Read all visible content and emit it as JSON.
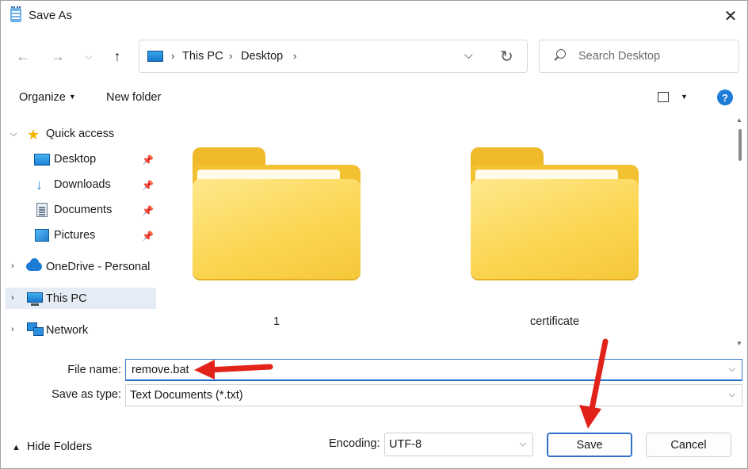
{
  "window": {
    "title": "Save As"
  },
  "nav": {
    "breadcrumb": [
      "This PC",
      "Desktop"
    ],
    "search_placeholder": "Search Desktop"
  },
  "commands": {
    "organize": "Organize",
    "new_folder": "New folder"
  },
  "sidebar": {
    "quick_access": "Quick access",
    "items": [
      {
        "label": "Desktop",
        "icon": "desktop-icon",
        "pinned": true
      },
      {
        "label": "Downloads",
        "icon": "download-icon",
        "pinned": true
      },
      {
        "label": "Documents",
        "icon": "documents-icon",
        "pinned": true
      },
      {
        "label": "Pictures",
        "icon": "pictures-icon",
        "pinned": true
      }
    ],
    "onedrive": "OneDrive - Personal",
    "this_pc": "This PC",
    "network": "Network",
    "selected": "This PC"
  },
  "folders": [
    {
      "name": "1"
    },
    {
      "name": "certificate"
    }
  ],
  "form": {
    "file_name_label": "File name:",
    "file_name_value": "remove.bat",
    "save_type_label": "Save as type:",
    "save_type_value": "Text Documents (*.txt)"
  },
  "footer": {
    "hide_folders": "Hide Folders",
    "encoding_label": "Encoding:",
    "encoding_value": "UTF-8",
    "save": "Save",
    "cancel": "Cancel"
  },
  "colors": {
    "accent": "#1f6dcc",
    "annotation_arrow": "#e2231a",
    "folder": "#f5c73a"
  }
}
